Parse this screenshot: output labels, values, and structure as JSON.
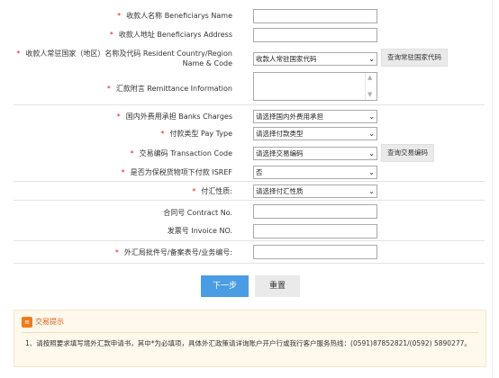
{
  "form": {
    "beneficiary_name": {
      "label": "收款人名称 Beneficiarys Name",
      "value": ""
    },
    "beneficiary_address": {
      "label": "收款人地址 Beneficiarys Address",
      "value": ""
    },
    "resident_country": {
      "label": "收款人常驻国家（地区）名称及代码 Resident Country/Region Name & Code",
      "selected": "收款人常驻国家代码",
      "query_label": "查询常驻国家代码"
    },
    "remittance_info": {
      "label": "汇款附言 Remittance Information",
      "value": ""
    },
    "bank_charges": {
      "label": "国内外费用承担 Banks Charges",
      "selected": "请选择国内外费用承担"
    },
    "pay_type": {
      "label": "付款类型 Pay Type",
      "selected": "请选择付款类型"
    },
    "transaction_code": {
      "label": "交易编码 Transaction Code",
      "selected": "请选择交易编码",
      "query_label": "查询交易编码"
    },
    "isref": {
      "label": "是否为保税货物项下付款 ISREF",
      "selected": "否"
    },
    "remit_nature": {
      "label": "付汇性质:",
      "selected": "请选择付汇性质"
    },
    "contract_no": {
      "label": "合同号 Contract No.",
      "value": ""
    },
    "invoice_no": {
      "label": "发票号 Invoice NO.",
      "value": ""
    },
    "approval_no": {
      "label": "外汇局批件号/备案表号/业务编号:",
      "value": ""
    },
    "required_mark": "*"
  },
  "actions": {
    "next_label": "下一步",
    "reset_label": "重置"
  },
  "tips": {
    "title": "交易提示",
    "text": "1、请按照要求填写境外汇款申请书，其中*为必填项，具体外汇政策请详询账户开户行或我行客户服务热线：(0591)87852821/(0592) 5890277。"
  },
  "colors": {
    "primary": "#4a9de4",
    "required": "#e02020",
    "tip_accent": "#f07b1c",
    "tip_bg": "#fff8ec"
  },
  "icons": {
    "select_arrow": "chevron-down-icon",
    "tip": "info-icon"
  }
}
